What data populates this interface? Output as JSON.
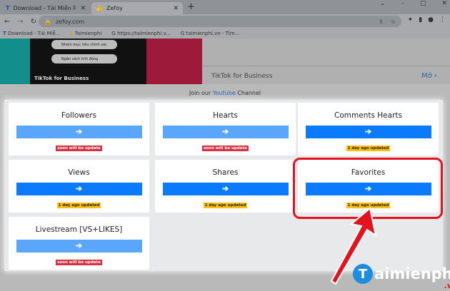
{
  "browser": {
    "tabs": [
      {
        "label": "Download - Tải Miễn Phí VN - Ph",
        "active": false
      },
      {
        "label": "Zefoy",
        "active": true
      }
    ],
    "url": "zefoy.com",
    "bookmarks": [
      "Download - Tải Miễ...",
      "Taimienphi",
      "https://taimienphi.v...",
      "taimienphi.vn - Tìm..."
    ]
  },
  "ad": {
    "pills": [
      "Nhóm mục tiêu chính xác",
      "Ngân sách linh động"
    ],
    "brand": "TikTok for Business",
    "title": "TikTok for Business",
    "open": "Mở"
  },
  "join": {
    "prefix": "Join our",
    "link": "Youtube",
    "suffix": "Channel"
  },
  "cards": [
    {
      "title": "Followers",
      "badge": "soon will be update"
    },
    {
      "title": "Hearts",
      "badge": "soon will be update"
    },
    {
      "title": "Comments Hearts",
      "badge": "1 day ago updated"
    },
    {
      "title": "Views",
      "badge": "1 day ago updated"
    },
    {
      "title": "Shares",
      "badge": "1 day ago updated"
    },
    {
      "title": "Favorites",
      "badge": "1 day ago updated"
    },
    {
      "title": "Livestream [VS+LIKES]",
      "badge": "soon will be update"
    }
  ],
  "button_icon": "➔",
  "watermark": {
    "text": "aimienphi",
    "suffix": ".vn",
    "initial": "T"
  }
}
